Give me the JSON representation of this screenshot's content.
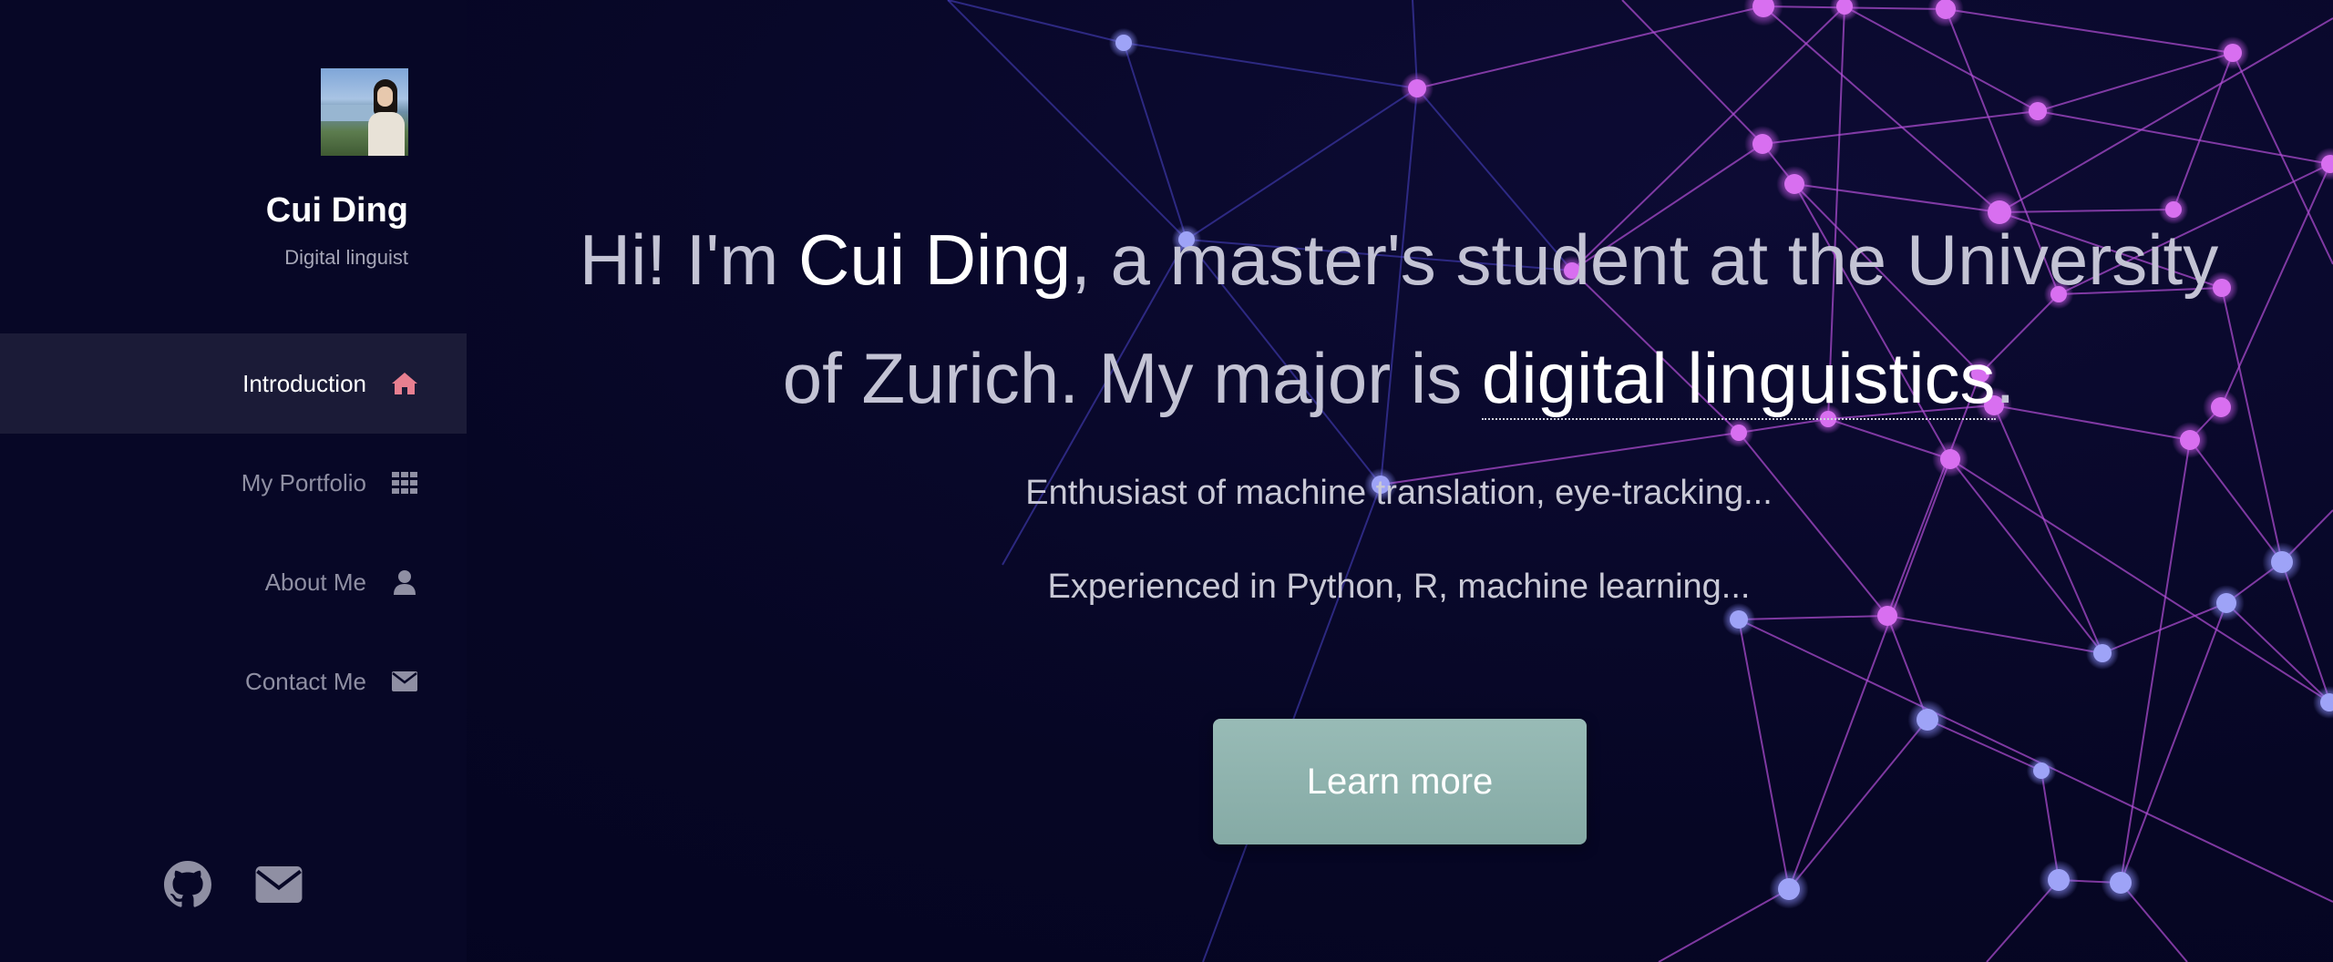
{
  "sidebar": {
    "name": "Cui Ding",
    "role": "Digital linguist",
    "avatar_alt": "profile photo",
    "nav": [
      {
        "label": "Introduction",
        "icon": "home-icon",
        "active": true
      },
      {
        "label": "My Portfolio",
        "icon": "grid-icon",
        "active": false
      },
      {
        "label": "About Me",
        "icon": "user-icon",
        "active": false
      },
      {
        "label": "Contact Me",
        "icon": "envelope-icon",
        "active": false
      }
    ],
    "social": [
      {
        "icon": "github-icon"
      },
      {
        "icon": "envelope-icon"
      }
    ]
  },
  "hero": {
    "headline_prefix": "Hi! I'm ",
    "headline_name": "Cui Ding",
    "headline_middle": ", a master's student at the University of Zurich. My major is ",
    "headline_major": "digital linguistics",
    "headline_suffix": ".",
    "tagline_1": "Enthusiast of machine translation, eye-tracking...",
    "tagline_2": "Experienced in Python, R, machine learning...",
    "cta_label": "Learn more"
  },
  "colors": {
    "background": "#060624",
    "sidebar_active": "#1b1b37",
    "home_icon_accent": "#e87f90",
    "button": "#8fb3ae",
    "network_purple": "#c04fe0",
    "network_blue": "#6e6af0"
  }
}
